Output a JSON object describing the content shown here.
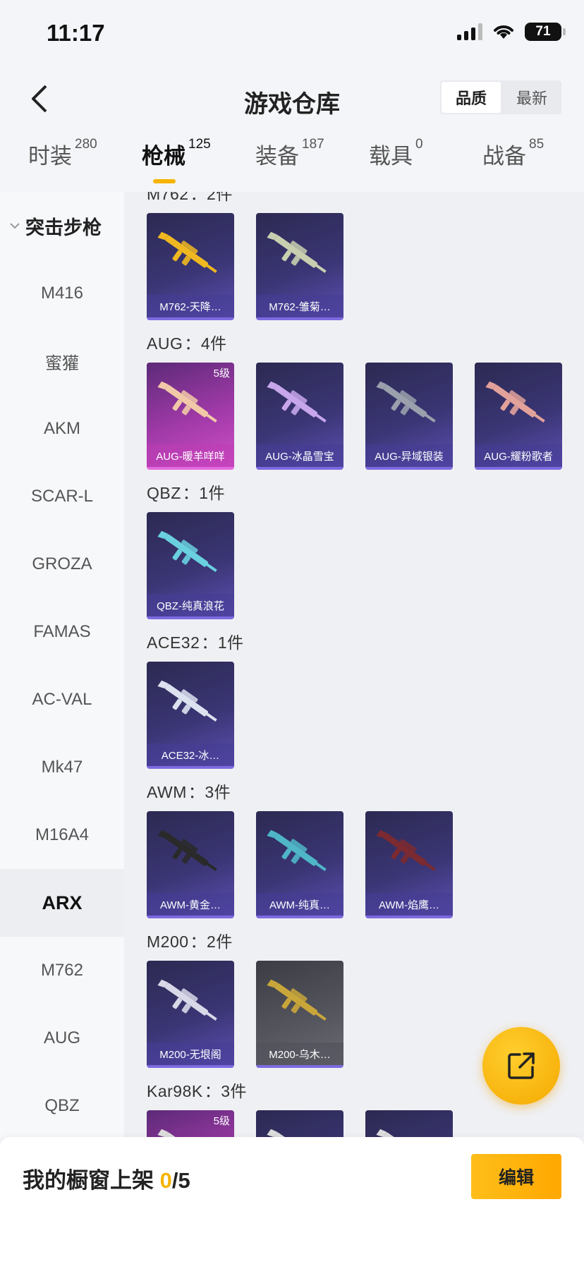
{
  "status_bar": {
    "time": "11:17",
    "battery": "71"
  },
  "header": {
    "title": "游戏仓库",
    "sort_options": [
      "品质",
      "最新"
    ],
    "active_sort": 0
  },
  "tabs": [
    {
      "label": "时装",
      "count": "280"
    },
    {
      "label": "枪械",
      "count": "125"
    },
    {
      "label": "装备",
      "count": "187"
    },
    {
      "label": "载具",
      "count": "0"
    },
    {
      "label": "战备",
      "count": "85"
    }
  ],
  "sidebar": {
    "group": "突击步枪",
    "items": [
      "M416",
      "蜜獾",
      "AKM",
      "SCAR-L",
      "GROZA",
      "FAMAS",
      "AC-VAL",
      "Mk47",
      "M16A4",
      "ARX",
      "M762",
      "AUG",
      "QBZ"
    ],
    "active": "ARX"
  },
  "groups": [
    {
      "name": "M762",
      "count_text": "：2件",
      "items": [
        {
          "label": "M762-天降…",
          "style": "purple",
          "gun_color": "#f0b820"
        },
        {
          "label": "M762-雏菊…",
          "style": "purple",
          "gun_color": "#c8cfb0"
        }
      ]
    },
    {
      "name": "AUG",
      "count_text": "：4件",
      "items": [
        {
          "label": "AUG-暖羊咩咩",
          "style": "pink",
          "badge": "5级",
          "gun_color": "#f2c9a8"
        },
        {
          "label": "AUG-冰晶雪宝",
          "style": "purple",
          "gun_color": "#c7a6ec"
        },
        {
          "label": "AUG-异域银装",
          "style": "purple",
          "gun_color": "#9aa0ac"
        },
        {
          "label": "AUG-耀粉歌者",
          "style": "purple",
          "gun_color": "#e2a29a"
        }
      ]
    },
    {
      "name": "QBZ",
      "count_text": "：1件",
      "items": [
        {
          "label": "QBZ-纯真浪花",
          "style": "purple",
          "gun_color": "#6ad0e0"
        }
      ]
    },
    {
      "name": "ACE32",
      "count_text": "：1件",
      "items": [
        {
          "label": "ACE32-冰…",
          "style": "purple",
          "gun_color": "#dde2f0"
        }
      ]
    },
    {
      "name": "AWM",
      "count_text": "：3件",
      "items": [
        {
          "label": "AWM-黄金…",
          "style": "purple",
          "gun_color": "#2a2a2a"
        },
        {
          "label": "AWM-纯真…",
          "style": "purple",
          "gun_color": "#4fb6c8"
        },
        {
          "label": "AWM-焰鹰…",
          "style": "purple",
          "gun_color": "#7a2a30"
        }
      ]
    },
    {
      "name": "M200",
      "count_text": "：2件",
      "items": [
        {
          "label": "M200-无垠阁",
          "style": "purple",
          "gun_color": "#d8d8e8"
        },
        {
          "label": "M200-乌木…",
          "style": "grey",
          "gun_color": "#c9a63a"
        }
      ]
    },
    {
      "name": "Kar98K",
      "count_text": "：3件",
      "items": [
        {
          "label": "",
          "style": "pink",
          "badge": "5级",
          "gun_color": "#ddd"
        },
        {
          "label": "",
          "style": "purple",
          "gun_color": "#ddd"
        },
        {
          "label": "",
          "style": "purple",
          "gun_color": "#ddd"
        }
      ]
    }
  ],
  "bottom": {
    "shelf_label": "我的橱窗上架 ",
    "shelf_current": "0",
    "shelf_total": "/5",
    "edit_label": "编辑"
  },
  "colors": {
    "accent": "#f5b400",
    "card_purple": "#3a3574",
    "card_pink": "#a13aa8"
  },
  "icons": {
    "back": "chevron-left-icon",
    "share": "share-external-icon",
    "group_toggle": "chevron-down-icon"
  }
}
